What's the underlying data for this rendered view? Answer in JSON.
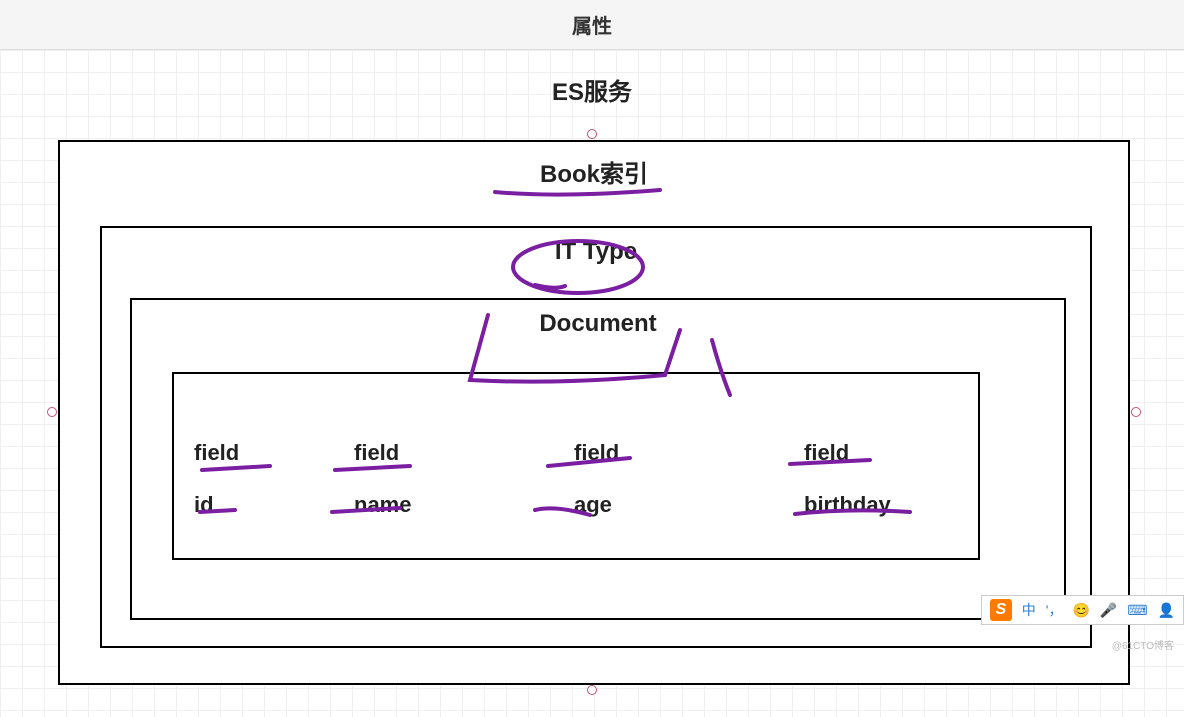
{
  "header": {
    "title": "属性"
  },
  "diagram": {
    "service_title": "ES服务",
    "index_title": "Book索引",
    "type_title": "IT Type",
    "document_title": "Document",
    "fields": [
      {
        "label_line1": "field",
        "label_line2": "id"
      },
      {
        "label_line1": "field",
        "label_line2": "name"
      },
      {
        "label_line1": "field",
        "label_line2": "age"
      },
      {
        "label_line1": "field",
        "label_line2": "birthday"
      }
    ]
  },
  "ime": {
    "logo": "S",
    "lang": "中",
    "punct": "'，",
    "items": [
      "😊",
      "🎤",
      "⌨",
      "👤"
    ]
  },
  "watermark": "@61CTO博客"
}
